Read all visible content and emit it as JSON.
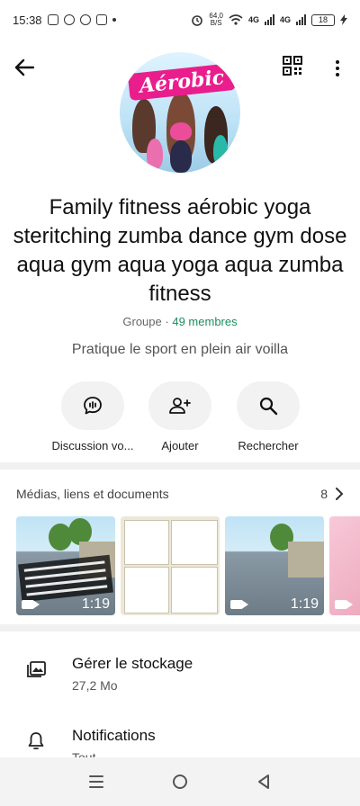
{
  "status_bar": {
    "time": "15:38",
    "net_speed": "64,0",
    "net_unit": "B/S",
    "signal_1": "4G",
    "signal_2": "4G",
    "battery": "18"
  },
  "group": {
    "title": "Family fitness aérobic yoga steritching  zumba dance  gym dose aqua gym aqua yoga aqua zumba fitness",
    "type": "Groupe",
    "separator": "·",
    "members": "49 membres",
    "description": "Pratique le sport en plein air voilla",
    "avatar_text": "Aérobic"
  },
  "actions": [
    {
      "label": "Discussion vo...",
      "icon": "voice-chat-icon"
    },
    {
      "label": "Ajouter",
      "icon": "add-person-icon"
    },
    {
      "label": "Rechercher",
      "icon": "search-icon"
    }
  ],
  "media": {
    "title": "Médias, liens et documents",
    "count": "8",
    "items": [
      {
        "kind": "video",
        "duration": "1:19"
      },
      {
        "kind": "image"
      },
      {
        "kind": "video",
        "duration": "1:19"
      },
      {
        "kind": "video"
      }
    ]
  },
  "settings": [
    {
      "title": "Gérer le stockage",
      "subtitle": "27,2 Mo",
      "icon": "storage-icon"
    },
    {
      "title": "Notifications",
      "subtitle": "Tout",
      "icon": "bell-icon"
    }
  ],
  "colors": {
    "accent_green": "#1e8c5e",
    "avatar_banner": "#e91e8c"
  }
}
